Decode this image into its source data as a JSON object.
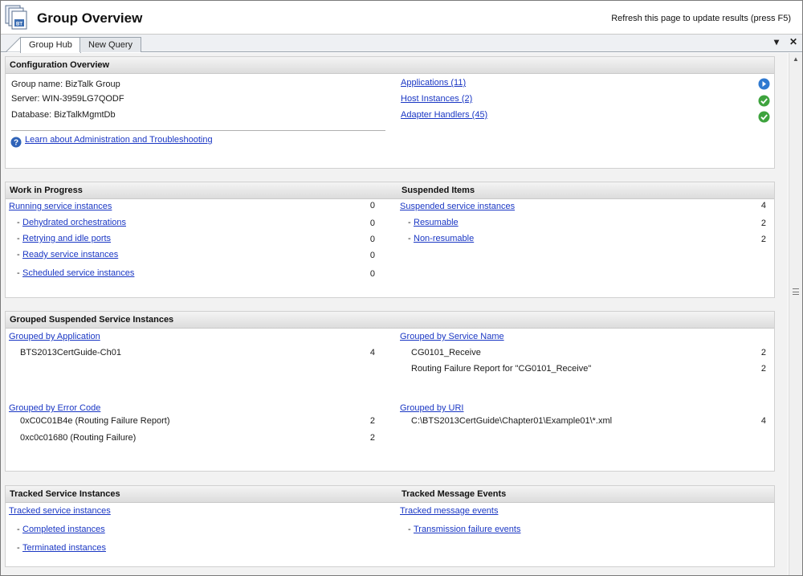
{
  "window": {
    "title": "Group Overview",
    "refresh_hint": "Refresh this page to update results (press F5)",
    "app_icon_badge": "BT"
  },
  "tabs": [
    {
      "label": "Group Hub",
      "active": true
    },
    {
      "label": "New Query",
      "active": false
    }
  ],
  "tab_controls": {
    "dropdown": "▾",
    "close": "✕"
  },
  "config": {
    "title": "Configuration Overview",
    "group_name": "Group name: BizTalk Group",
    "server": "Server: WIN-3959LG7QODF",
    "database": "Database: BizTalkMgmtDb",
    "help_link": "Learn about Administration and Troubleshooting",
    "links": [
      {
        "label": "Applications (11)",
        "icon": "info-arrow-icon",
        "icon_color": "#2f79d0"
      },
      {
        "label": "Host Instances (2)",
        "icon": "ok-check-icon",
        "icon_color": "#3ea33e"
      },
      {
        "label": "Adapter Handlers (45)",
        "icon": "ok-check-icon",
        "icon_color": "#3ea33e"
      }
    ]
  },
  "work": {
    "title": "Work in Progress",
    "main": {
      "label": "Running service instances",
      "count": "0"
    },
    "items": [
      {
        "label": "Dehydrated orchestrations",
        "count": "0"
      },
      {
        "label": "Retrying and idle ports",
        "count": "0"
      },
      {
        "label": "Ready service instances",
        "count": "0"
      },
      {
        "label": "Scheduled service instances",
        "count": "0"
      }
    ]
  },
  "suspended": {
    "title": "Suspended Items",
    "main": {
      "label": "Suspended service instances",
      "count": "4"
    },
    "items": [
      {
        "label": "Resumable",
        "count": "2"
      },
      {
        "label": "Non-resumable",
        "count": "2"
      }
    ]
  },
  "grouped": {
    "title": "Grouped Suspended Service Instances",
    "by_application": {
      "label": "Grouped by Application",
      "rows": [
        {
          "name": "BTS2013CertGuide-Ch01",
          "count": "4"
        }
      ]
    },
    "by_service": {
      "label": "Grouped by Service Name",
      "rows": [
        {
          "name": "CG0101_Receive",
          "count": "2"
        },
        {
          "name": "Routing Failure Report for \"CG0101_Receive\"",
          "count": "2"
        }
      ]
    },
    "by_error": {
      "label": "Grouped by Error Code",
      "rows": [
        {
          "name": "0xC0C01B4e (Routing Failure Report)",
          "count": "2"
        },
        {
          "name": "0xc0c01680 (Routing Failure)",
          "count": "2"
        }
      ]
    },
    "by_uri": {
      "label": "Grouped by URI",
      "rows": [
        {
          "name": "C:\\BTS2013CertGuide\\Chapter01\\Example01\\*.xml",
          "count": "4"
        }
      ]
    }
  },
  "tracked_services": {
    "title": "Tracked Service Instances",
    "main": "Tracked service instances",
    "items": [
      "Completed instances",
      "Terminated instances"
    ]
  },
  "tracked_messages": {
    "title": "Tracked Message Events",
    "main": "Tracked message events",
    "items": [
      "Transmission failure events"
    ]
  },
  "dash_char": "-",
  "colors": {
    "link": "#1a37c4",
    "ok": "#3ea33e",
    "info": "#2f79d0",
    "header_bg": "#dcdcdc"
  }
}
